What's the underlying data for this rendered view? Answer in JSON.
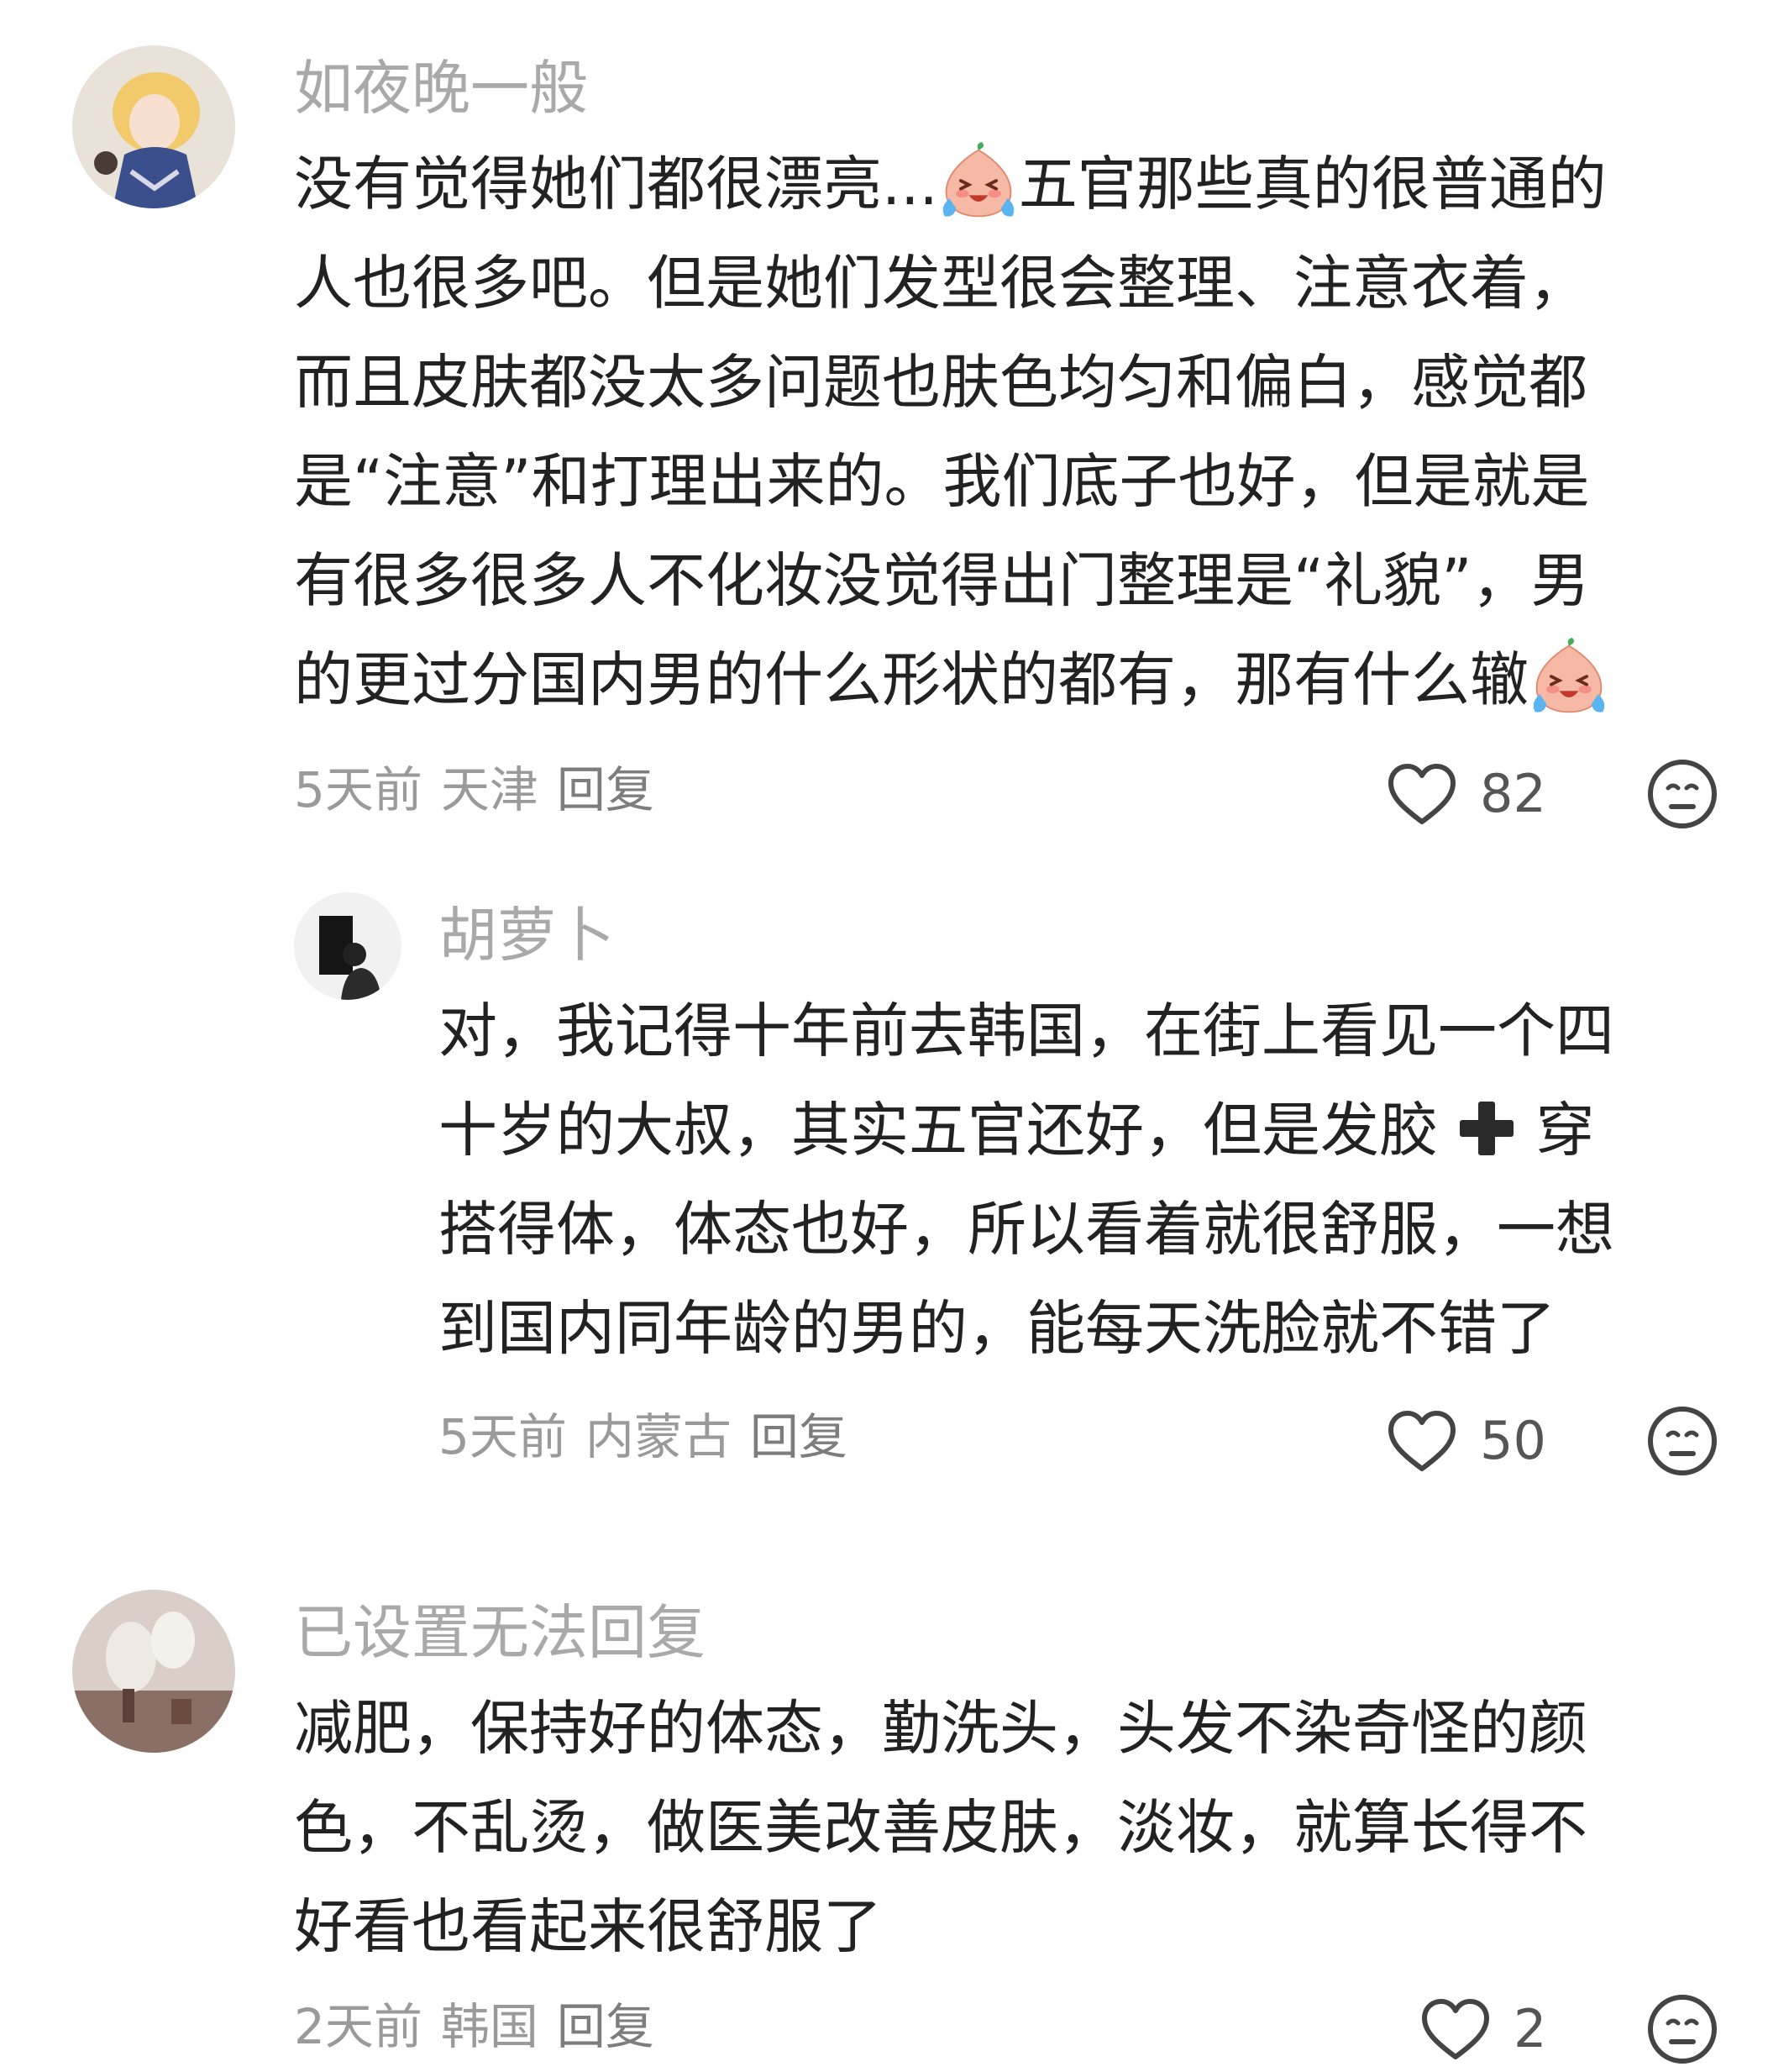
{
  "comments": [
    {
      "username": "如夜晚一般",
      "lines": [
        "没有觉得她们都很漂亮...",
        "五官那些真的很普通的",
        "人也很多吧。但是她们发型很会整理、注意衣着，",
        "而且皮肤都没太多问题也肤色均匀和偏白，感觉都",
        "是“注意”和打理出来的。我们底子也好，但是就是",
        "有很多很多人不化妆没觉得出门整理是“礼貌”，男",
        "的更过分国内男的什么形状的都有，那有什么辙"
      ],
      "time": "5天前",
      "location": "天津",
      "reply_label": "回复",
      "likes": "82"
    },
    {
      "username": "胡萝卜",
      "lines": [
        "对，我记得十年前去韩国，在街上看见一个四",
        "十岁的大叔，其实五官还好，但是发胶",
        "穿",
        "搭得体，体态也好，所以看着就很舒服，一想",
        "到国内同年龄的男的，能每天洗脸就不错了"
      ],
      "time": "5天前",
      "location": "内蒙古",
      "reply_label": "回复",
      "likes": "50"
    },
    {
      "username": "已设置无法回复",
      "lines": [
        "减肥，保持好的体态，勤洗头，头发不染奇怪的颜",
        "色，不乱烫，做医美改善皮肤，淡妆，就算长得不",
        "好看也看起来很舒服了"
      ],
      "time": "2天前",
      "location": "韩国",
      "reply_label": "回复",
      "likes": "2"
    }
  ],
  "icons": {
    "crying_emoji": "crying-laughing-emoji",
    "like": "heart-outline-icon",
    "dislike": "meh-face-icon",
    "plus": "heavy-plus-icon"
  },
  "colors": {
    "username": "#a9a9a9",
    "body_text": "#222222",
    "meta": "#9a9a9a",
    "icon_stroke": "#444444"
  }
}
